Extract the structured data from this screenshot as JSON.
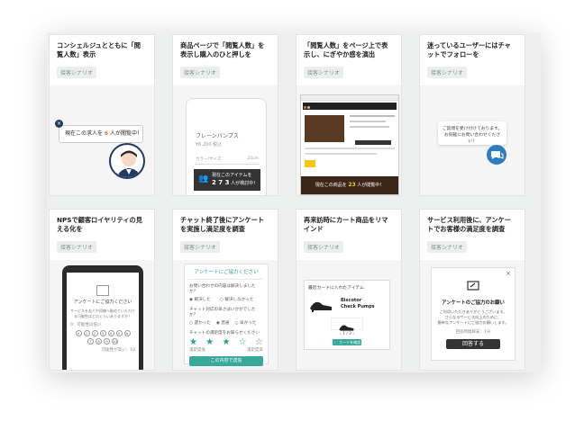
{
  "cards": [
    {
      "title": "コンシェルジュとともに「閲覧人数」表示",
      "tag": "接客シナリオ",
      "bubble_pre": "現在この求人を ",
      "bubble_num": "6",
      "bubble_post": " 人が閲覧中！"
    },
    {
      "title": "商品ページで「閲覧人数」を表示し購入のひと押しを",
      "tag": "接客シナリオ",
      "product": "フレーンパンプス",
      "price": "¥6,200",
      "price_note": "税込",
      "size_label": "カラー/サイズ",
      "size_value": "25cm",
      "popup_line1": "現在このアイテムを",
      "popup_num": "2 7 3",
      "popup_line2": "人が検討中！"
    },
    {
      "title": "「閲覧人数」をページ上で表示し、にぎやか感を演出",
      "tag": "接客シナリオ",
      "banner_pre": "現在この商品を ",
      "banner_num": "23",
      "banner_post": " 人が閲覧中！"
    },
    {
      "title": "迷っているユーザーにはチャットでフォローを",
      "tag": "接客シナリオ",
      "chat_line1": "ご質問を受け付けております。",
      "chat_line2": "お気軽にお問い合わせください！"
    },
    {
      "title": "NPSで顧客ロイヤリティの見える化を",
      "tag": "接客シナリオ",
      "survey_title": "アンケートにご協力ください",
      "survey_q": "サービスを友人や同僚へ勧めていただける可能性はどのくらいありますか？",
      "scale_low": "0：可能性は低い",
      "scale_high": "可能性が高い：10",
      "numbers": [
        "0",
        "1",
        "2",
        "3",
        "4",
        "5",
        "6",
        "7",
        "8",
        "9",
        "10"
      ]
    },
    {
      "title": "チャット終了後にアンケートを実施し満足度を調査",
      "tag": "接客シナリオ",
      "header": "アンケートにご協力ください",
      "q1": "お問い合わせの内容は解決しましたか？",
      "q1_a": "解決した",
      "q1_b": "解決しなかった",
      "q2": "チャット対応の早さはいかがでしたか？",
      "q2_a": "遅かった",
      "q2_b": "普通",
      "q2_c": "早かった",
      "q3": "チャットの満足度をお知らせください",
      "star_low": "満足度低",
      "star_high": "満足度高",
      "submit": "この内容で送信"
    },
    {
      "title": "再来訪時にカート商品をリマインド",
      "tag": "接客シナリオ",
      "box_title": "最近カートに入れたアイテム",
      "product_line1": "Biscotor",
      "product_line2": "Check Pumps",
      "pager": "1 / 3",
      "cart_btn": "カートを確認"
    },
    {
      "title": "サービス利用後に、アンケートでお客様の満足度を調査",
      "tag": "接客シナリオ",
      "modal_title": "アンケートのご協力のお願い",
      "modal_text1": "ご利用いただきありがとうございます。",
      "modal_text2": "さらなるサービス向上のために、",
      "modal_text3": "簡単なアンケートにご協力お願いします。",
      "modal_meta": "回答時間目安：1分",
      "answer_btn": "回答する"
    }
  ],
  "colors": {
    "accent": "#2a9d8f",
    "chat": "#2d7dbf",
    "dark": "#333333"
  }
}
